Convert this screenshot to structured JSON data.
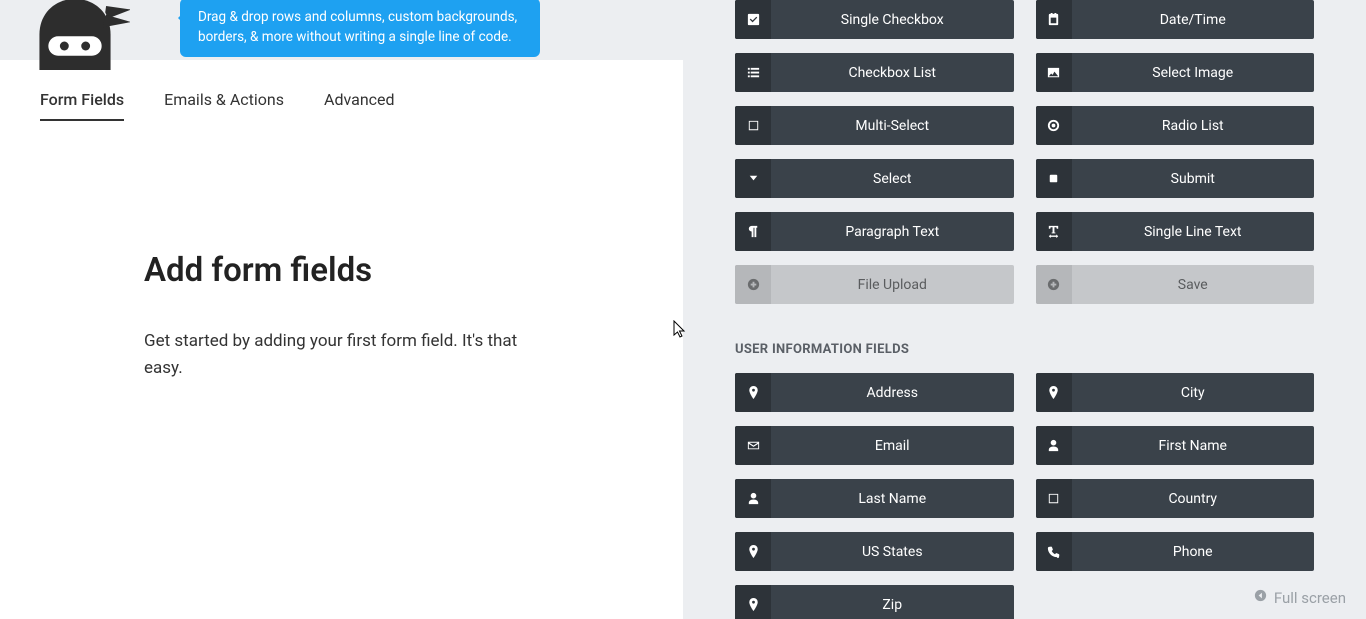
{
  "tooltip": "Drag & drop rows and columns, custom backgrounds, borders, & more without writing a single line of code.",
  "tabs": {
    "form_fields": "Form Fields",
    "emails_actions": "Emails & Actions",
    "advanced": "Advanced"
  },
  "main": {
    "title": "Add form fields",
    "description": "Get started by adding your first form field. It's that easy."
  },
  "common_fields": [
    {
      "label": "Single Checkbox",
      "icon": "check-square"
    },
    {
      "label": "Date/Time",
      "icon": "calendar"
    },
    {
      "label": "Checkbox List",
      "icon": "list-ul"
    },
    {
      "label": "Select Image",
      "icon": "image"
    },
    {
      "label": "Multi-Select",
      "icon": "square-o"
    },
    {
      "label": "Radio List",
      "icon": "dot-circle"
    },
    {
      "label": "Select",
      "icon": "chevron-down"
    },
    {
      "label": "Submit",
      "icon": "square"
    },
    {
      "label": "Paragraph Text",
      "icon": "paragraph"
    },
    {
      "label": "Single Line Text",
      "icon": "text-width"
    },
    {
      "label": "File Upload",
      "icon": "plus-circle",
      "disabled": true
    },
    {
      "label": "Save",
      "icon": "plus-circle",
      "disabled": true
    }
  ],
  "user_section_title": "USER INFORMATION FIELDS",
  "user_fields": [
    {
      "label": "Address",
      "icon": "map-pin"
    },
    {
      "label": "City",
      "icon": "map-pin"
    },
    {
      "label": "Email",
      "icon": "envelope"
    },
    {
      "label": "First Name",
      "icon": "user"
    },
    {
      "label": "Last Name",
      "icon": "user"
    },
    {
      "label": "Country",
      "icon": "square-o"
    },
    {
      "label": "US States",
      "icon": "map-pin"
    },
    {
      "label": "Phone",
      "icon": "phone"
    },
    {
      "label": "Zip",
      "icon": "map-pin"
    }
  ],
  "fullscreen_label": "Full screen"
}
